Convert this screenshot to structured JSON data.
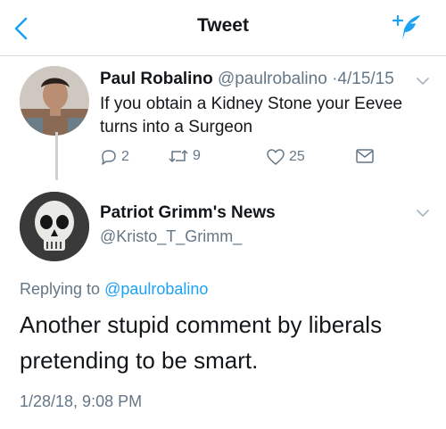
{
  "header": {
    "title": "Tweet",
    "back_icon": "chevron-left-icon",
    "compose_icon": "compose-tweet-icon",
    "accent_color": "#1da1f2"
  },
  "parent_tweet": {
    "name": "Paul Robalino",
    "handle": "@paulrobalino",
    "separator": "·",
    "date": "4/15/15",
    "text": "If you obtain a Kidney Stone your Eevee turns into a Surgeon",
    "replies": "2",
    "retweets": "9",
    "likes": "25"
  },
  "main_tweet": {
    "name": "Patriot Grimm's News",
    "handle": "@Kristo_T_Grimm_",
    "replying_prefix": "Replying to",
    "replying_to": "@paulrobalino",
    "text": "Another stupid comment by liberals pretending to be smart.",
    "timestamp": "1/28/18, 9:08 PM"
  }
}
